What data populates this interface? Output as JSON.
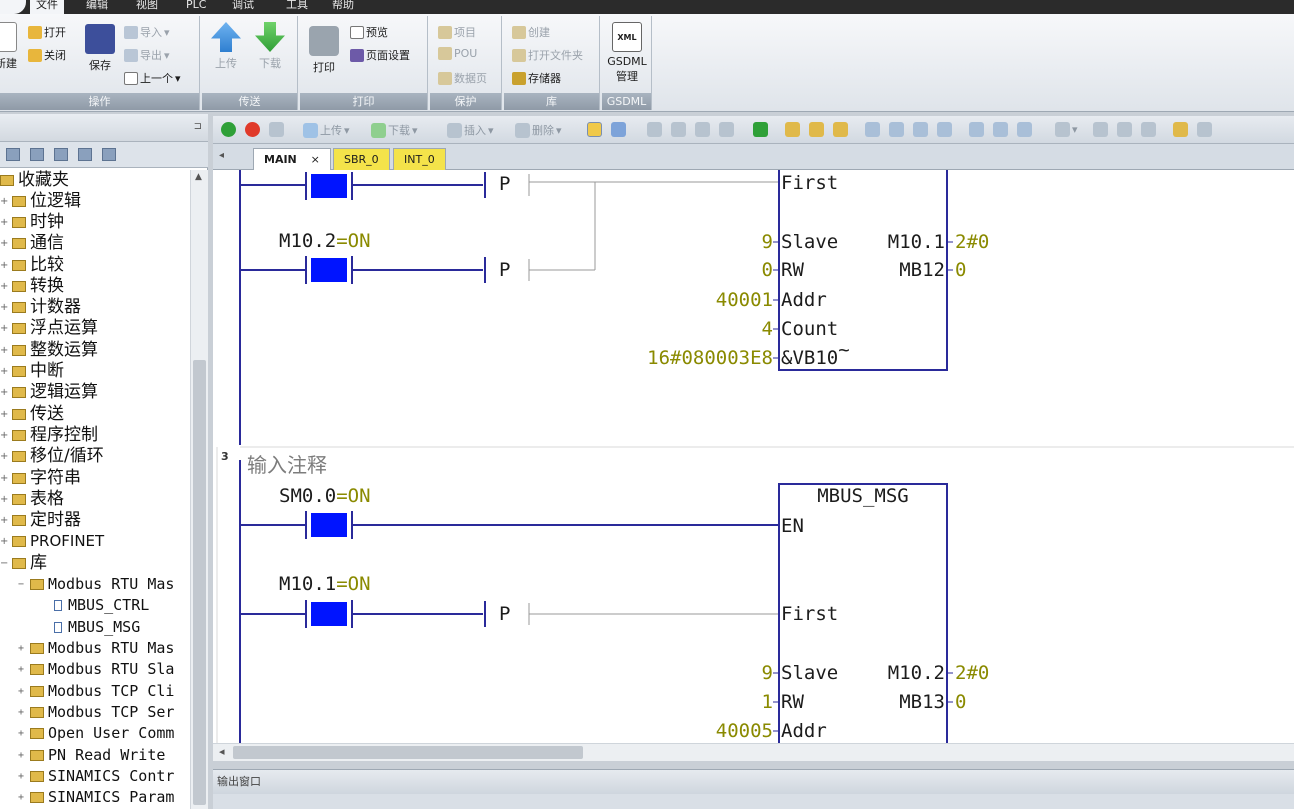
{
  "menu": {
    "items": [
      "文件",
      "编辑",
      "视图",
      "PLC",
      "调试",
      "工具",
      "帮助"
    ]
  },
  "ribbon": {
    "groups": [
      {
        "label": "操作",
        "buttons": {
          "new": "新建",
          "open": "打开",
          "close": "关闭",
          "save": "保存",
          "import": "导入",
          "export": "导出",
          "prev": "上一个"
        }
      },
      {
        "label": "传送",
        "buttons": {
          "upload": "上传",
          "download": "下载"
        }
      },
      {
        "label": "打印",
        "buttons": {
          "print": "打印",
          "preview": "预览",
          "page_setup": "页面设置"
        }
      },
      {
        "label": "保护",
        "buttons": {
          "project": "项目",
          "pou": "POU",
          "data_page": "数据页"
        }
      },
      {
        "label": "库",
        "buttons": {
          "create": "创建",
          "open_folder": "打开文件夹",
          "memory": "存储器"
        }
      },
      {
        "label": "GSDML",
        "buttons": {
          "gsdml": "GSDML",
          "manage": "管理",
          "xml_badge": "XML"
        }
      }
    ]
  },
  "tree": {
    "items": [
      {
        "label": "收藏夹"
      },
      {
        "label": "位逻辑"
      },
      {
        "label": "时钟"
      },
      {
        "label": "通信"
      },
      {
        "label": "比较"
      },
      {
        "label": "转换"
      },
      {
        "label": "计数器"
      },
      {
        "label": "浮点运算"
      },
      {
        "label": "整数运算"
      },
      {
        "label": "中断"
      },
      {
        "label": "逻辑运算"
      },
      {
        "label": "传送"
      },
      {
        "label": "程序控制"
      },
      {
        "label": "移位/循环"
      },
      {
        "label": "字符串"
      },
      {
        "label": "表格"
      },
      {
        "label": "定时器"
      },
      {
        "label": "PROFINET"
      },
      {
        "label": "库"
      },
      {
        "label": "Modbus RTU Mas"
      },
      {
        "label": "MBUS_CTRL"
      },
      {
        "label": "MBUS_MSG"
      },
      {
        "label": "Modbus RTU Mas"
      },
      {
        "label": "Modbus RTU Sla"
      },
      {
        "label": "Modbus TCP Cli"
      },
      {
        "label": "Modbus TCP Ser"
      },
      {
        "label": "Open User Comm"
      },
      {
        "label": "PN Read Write"
      },
      {
        "label": "SINAMICS Contr"
      },
      {
        "label": "SINAMICS Param"
      }
    ]
  },
  "editor_toolbar": {
    "upload": "上传",
    "download": "下载",
    "insert": "插入",
    "delete": "删除"
  },
  "tabs": [
    {
      "label": "MAIN",
      "close": "×"
    },
    {
      "label": "SBR_0"
    },
    {
      "label": "INT_0"
    }
  ],
  "ladder": {
    "net2": {
      "contact_m102": {
        "name": "M10.2",
        "state": "=ON"
      },
      "p_label": "P",
      "block_pins": {
        "first": "First",
        "slave": "Slave",
        "rw": "RW",
        "addr": "Addr",
        "count": "Count",
        "dataptr": "&VB10"
      },
      "pin_values": {
        "slave": "9",
        "rw": "0",
        "addr": "40001",
        "count": "4",
        "dataptr": "16#080003E8"
      },
      "outputs": {
        "done": "M10.1",
        "done_val": "2#0",
        "error": "MB12",
        "error_val": "0"
      },
      "tilde": "~"
    },
    "net3": {
      "number": "3",
      "comment": "输入注释",
      "block_title": "MBUS_MSG",
      "contact_sm00": {
        "name": "SM0.0",
        "state": "=ON"
      },
      "contact_m101": {
        "name": "M10.1",
        "state": "=ON"
      },
      "p_label": "P",
      "block_pins": {
        "en": "EN",
        "first": "First",
        "slave": "Slave",
        "rw": "RW",
        "addr": "Addr"
      },
      "pin_values": {
        "slave": "9",
        "rw": "1",
        "addr": "40005"
      },
      "outputs": {
        "done": "M10.2",
        "done_val": "2#0",
        "error": "MB13",
        "error_val": "0"
      }
    }
  },
  "output_window": {
    "title": "输出窗口"
  },
  "colors": {
    "contact_fill": "#0014ff",
    "value_color": "#8a8a00",
    "block_border": "#2a2a9a",
    "tab_yellow": "#f4e34a"
  }
}
